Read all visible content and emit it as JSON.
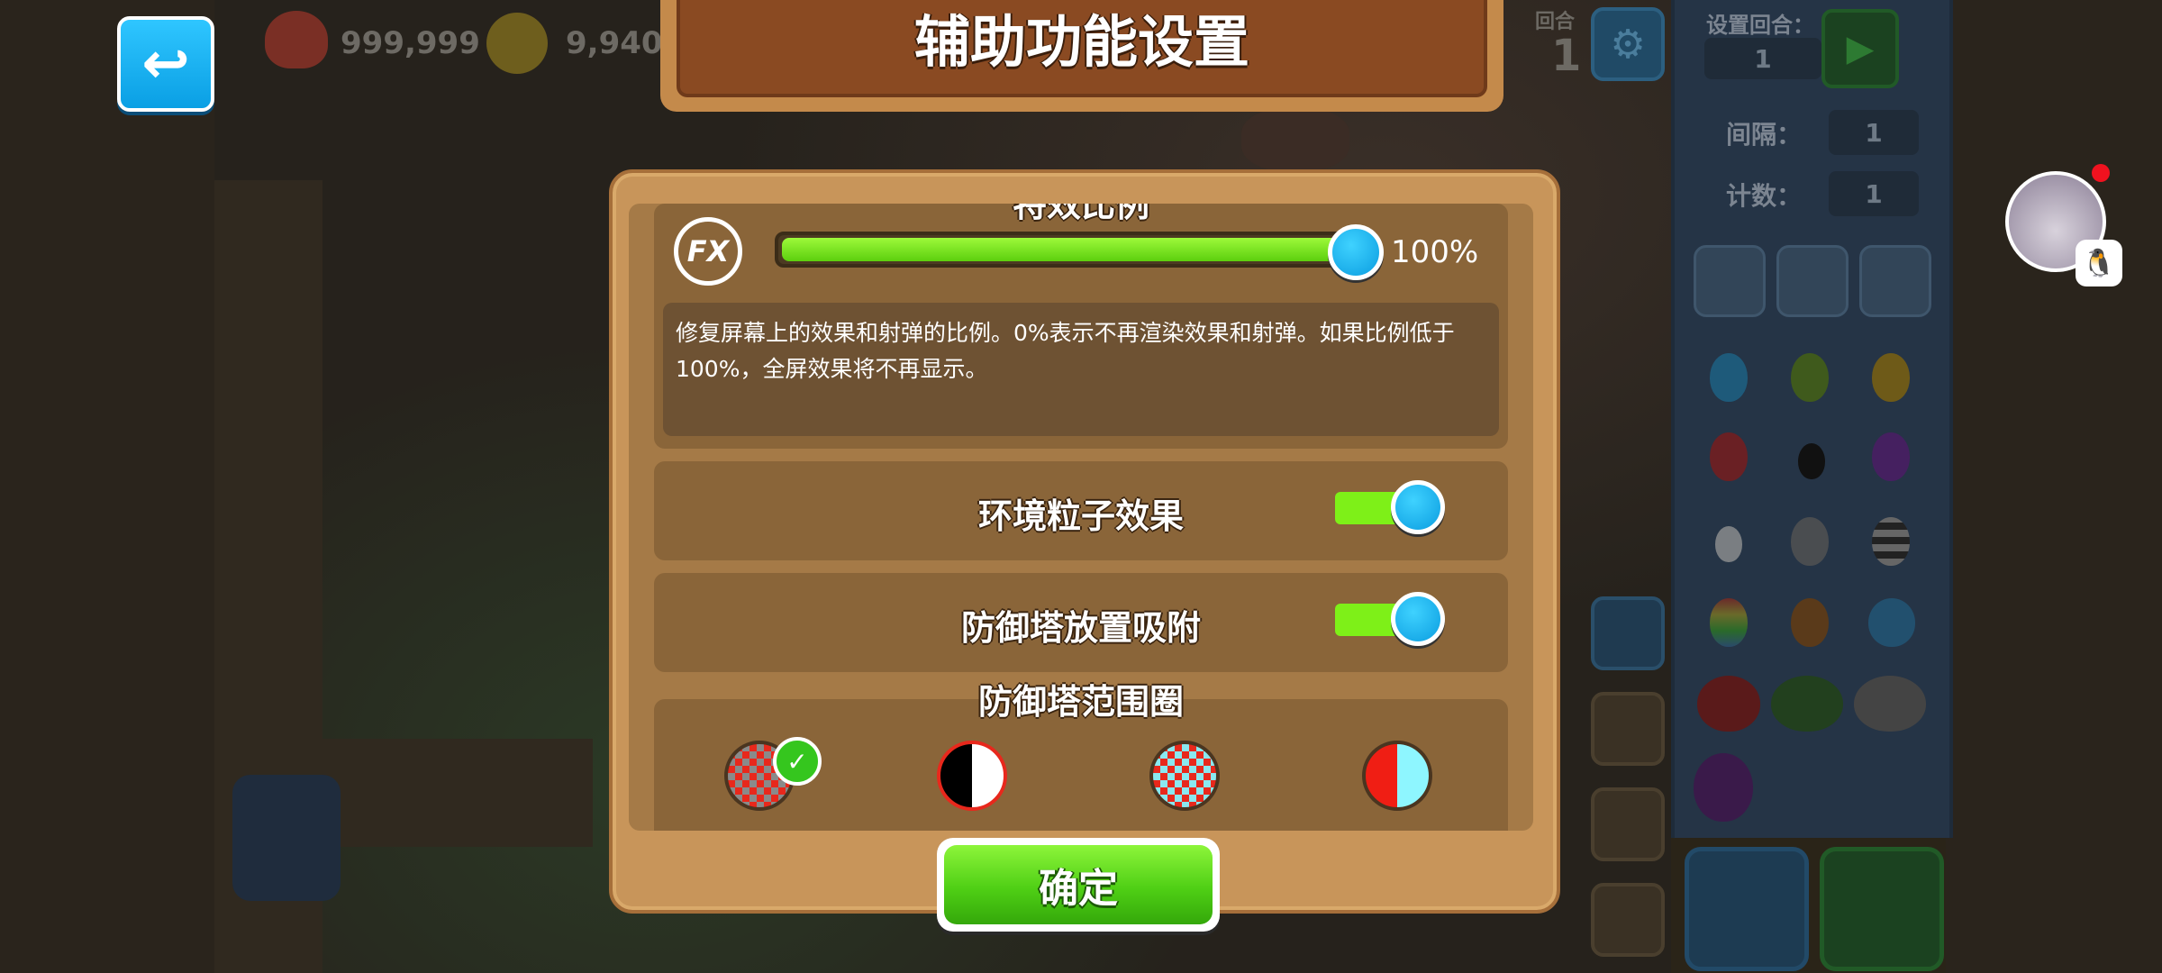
{
  "hud": {
    "lives": "999,999",
    "cash": "9,940",
    "round_label": "回合",
    "round_value": "1"
  },
  "sidebar": {
    "set_round_label": "设置回合：",
    "set_round_value": "1",
    "interval_label": "间隔：",
    "interval_value": "1",
    "count_label": "计数：",
    "count_value": "1"
  },
  "modal": {
    "title": "辅助功能设置",
    "fx_section_title": "特效比例",
    "fx_badge": "FX",
    "fx_percent_label": "100%",
    "fx_value_percent": 100,
    "fx_description": "修复屏幕上的效果和射弹的比例。0%表示不再渲染效果和射弹。如果比例低于100%，全屏效果将不再显示。",
    "ambient_particles_label": "环境粒子效果",
    "ambient_particles_on": true,
    "tower_snap_label": "防御塔放置吸附",
    "tower_snap_on": true,
    "range_circle_title": "防御塔范围圈",
    "range_options": [
      "red-checker-gray",
      "black-white",
      "red-checker-cyan",
      "red-cyan"
    ],
    "range_selected_index": 0,
    "confirm_label": "确定"
  },
  "colors": {
    "accent_green": "#5ccf0e",
    "knob_blue": "#0b9de0",
    "panel_brown": "#c8955a",
    "banner_brown": "#8a4a22"
  }
}
